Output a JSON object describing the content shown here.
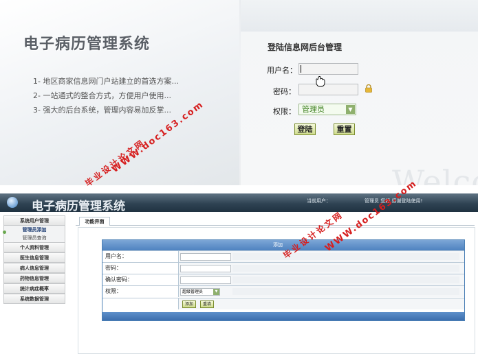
{
  "login_page": {
    "brand": "电子病历管理系统",
    "slogans": [
      "1- 地区商家信息网门户站建立的首选方案...",
      "2- 一站通式的整合方式，方便用户使用...",
      "3- 强大的后台系统，管理内容易加反掌..."
    ],
    "title": "登陆信息网后台管理",
    "username_label": "用户名：",
    "password_label": "密码：",
    "role_label": "权限：",
    "role_value": "管理员",
    "login_button": "登陆",
    "reset_button": "重置",
    "background_text": "Welco"
  },
  "watermarks": {
    "site": "WWW.doc163.com",
    "cn": "毕业设计论文网"
  },
  "admin_page": {
    "header_title": "电子病历管理系统",
    "current_user": "当前用户：",
    "welcome": "管理员  您好,感谢登陆使用!",
    "sidebar": {
      "items": [
        "系统用户管理",
        "管理员添加",
        "管理员查询",
        "个人资料管理",
        "医生信息管理",
        "病人信息管理",
        "药物信息管理",
        "统计病症概率",
        "系统数据管理"
      ]
    },
    "tab_main": "功能界面",
    "form": {
      "header": "添加",
      "username_label": "用户名：",
      "password_label": "密码：",
      "confirm_label": "确认密码：",
      "role_label": "权限：",
      "role_value": "超级管理员",
      "add_button": "添加",
      "reset_button": "重填"
    }
  },
  "colors": {
    "header_dark": "#2f4353",
    "accent_blue": "#4e82c0",
    "watermark_red": "#d61f1f",
    "button_green": "#cfdc8e"
  }
}
